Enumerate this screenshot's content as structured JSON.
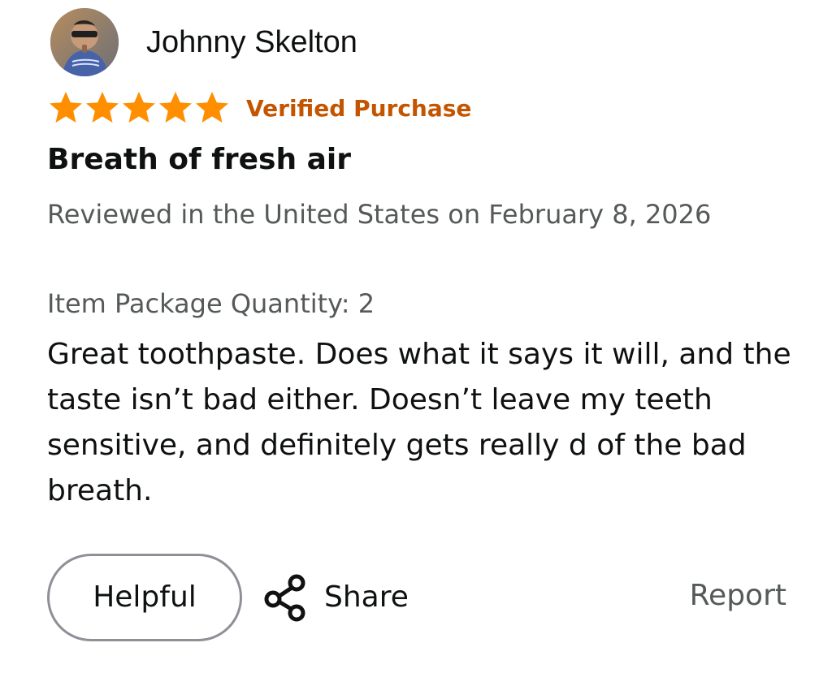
{
  "reviewer": {
    "name": "Johnny Skelton",
    "avatar_icon": "profile-avatar"
  },
  "rating": {
    "value": 5,
    "max": 5,
    "star_icon": "star-icon",
    "star_color": "#ff8f00"
  },
  "badge": {
    "label": "Verified Purchase",
    "color": "#c45500"
  },
  "review": {
    "title": "Breath of fresh air",
    "meta": "Reviewed in the United States on February 8, 2026",
    "variant": "Item Package Quantity: 2",
    "body": "Great toothpaste. Does what it says it will, and the taste isn’t bad either. Doesn’t leave my teeth sensitive, and definitely gets really d of the bad breath."
  },
  "actions": {
    "helpful_label": "Helpful",
    "share_label": "Share",
    "share_icon": "share-icon",
    "report_label": "Report"
  }
}
